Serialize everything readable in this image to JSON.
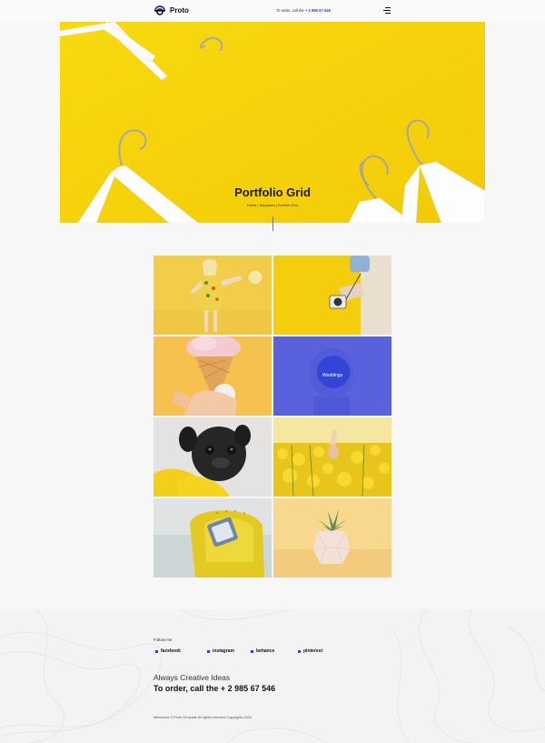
{
  "header": {
    "logo_text": "Proto",
    "phone_prefix": "To order, call the",
    "phone_number": "+ 2 985 67 546",
    "menu_icon": "hamburger-icon"
  },
  "hero": {
    "title": "Portfolio Grid",
    "breadcrumb": "Home | Templates | Portfolio Grid",
    "background_color": "#f5d20e"
  },
  "portfolio": {
    "tiles": [
      {
        "image": "woman-in-yellow-dress-photo"
      },
      {
        "image": "hand-with-camera-photo"
      },
      {
        "image": "ice-cream-cone-photo"
      },
      {
        "image": "photographer-photo",
        "hover_label": "Weddings"
      },
      {
        "image": "pug-in-yellow-hoodie-photo"
      },
      {
        "image": "yellow-flower-field-photo"
      },
      {
        "image": "yellow-armchair-photo"
      },
      {
        "image": "succulent-pot-photo"
      }
    ]
  },
  "footer": {
    "follow_label": "Follow me",
    "socials": [
      "facebook",
      "instagram",
      "behance",
      "pinterest"
    ],
    "tagline": "Always Creative Ideas",
    "order_text": "To order, call the + 2 985 67 546",
    "copyright": "Merkulove © Proto Template All rights reserved Copyrights 2020"
  },
  "colors": {
    "accent": "#2b43d8",
    "hero_yellow": "#f5d20e",
    "overlay_blue": "#4650dc"
  }
}
